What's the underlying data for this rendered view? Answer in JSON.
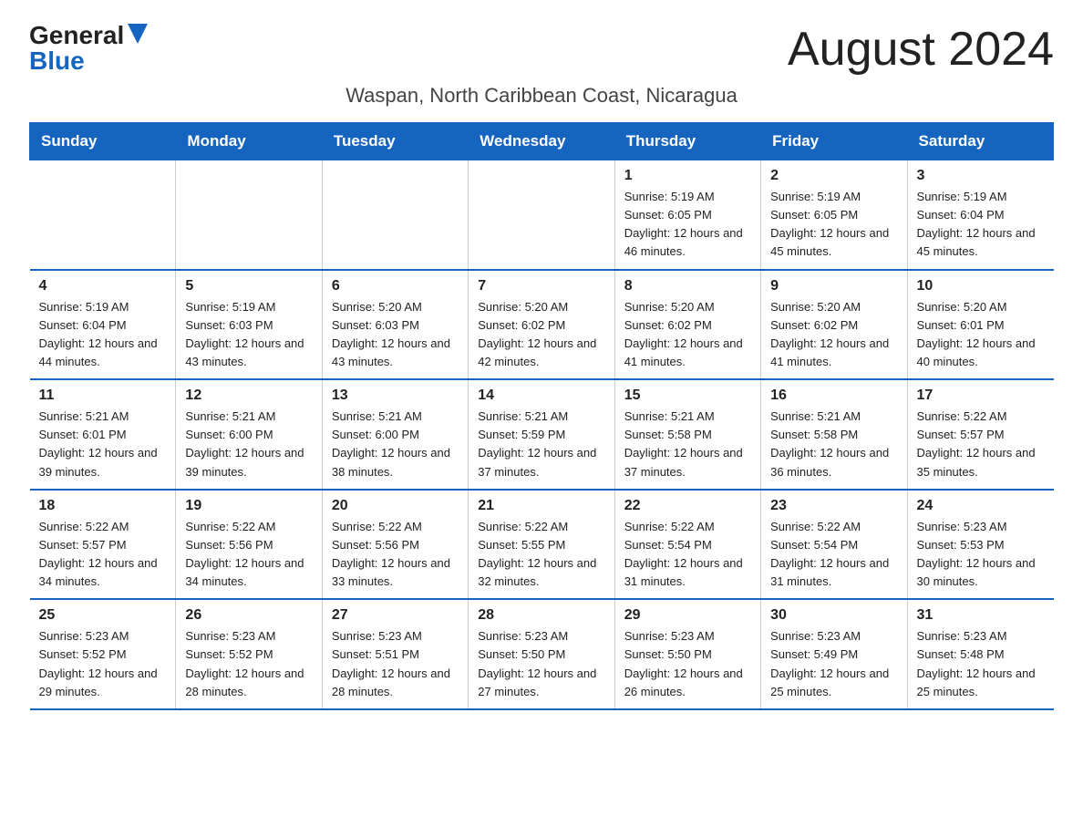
{
  "logo": {
    "general": "General",
    "blue": "Blue"
  },
  "page_title": "August 2024",
  "subtitle": "Waspan, North Caribbean Coast, Nicaragua",
  "header_days": [
    "Sunday",
    "Monday",
    "Tuesday",
    "Wednesday",
    "Thursday",
    "Friday",
    "Saturday"
  ],
  "weeks": [
    [
      {
        "day": "",
        "sunrise": "",
        "sunset": "",
        "daylight": ""
      },
      {
        "day": "",
        "sunrise": "",
        "sunset": "",
        "daylight": ""
      },
      {
        "day": "",
        "sunrise": "",
        "sunset": "",
        "daylight": ""
      },
      {
        "day": "",
        "sunrise": "",
        "sunset": "",
        "daylight": ""
      },
      {
        "day": "1",
        "sunrise": "Sunrise: 5:19 AM",
        "sunset": "Sunset: 6:05 PM",
        "daylight": "Daylight: 12 hours and 46 minutes."
      },
      {
        "day": "2",
        "sunrise": "Sunrise: 5:19 AM",
        "sunset": "Sunset: 6:05 PM",
        "daylight": "Daylight: 12 hours and 45 minutes."
      },
      {
        "day": "3",
        "sunrise": "Sunrise: 5:19 AM",
        "sunset": "Sunset: 6:04 PM",
        "daylight": "Daylight: 12 hours and 45 minutes."
      }
    ],
    [
      {
        "day": "4",
        "sunrise": "Sunrise: 5:19 AM",
        "sunset": "Sunset: 6:04 PM",
        "daylight": "Daylight: 12 hours and 44 minutes."
      },
      {
        "day": "5",
        "sunrise": "Sunrise: 5:19 AM",
        "sunset": "Sunset: 6:03 PM",
        "daylight": "Daylight: 12 hours and 43 minutes."
      },
      {
        "day": "6",
        "sunrise": "Sunrise: 5:20 AM",
        "sunset": "Sunset: 6:03 PM",
        "daylight": "Daylight: 12 hours and 43 minutes."
      },
      {
        "day": "7",
        "sunrise": "Sunrise: 5:20 AM",
        "sunset": "Sunset: 6:02 PM",
        "daylight": "Daylight: 12 hours and 42 minutes."
      },
      {
        "day": "8",
        "sunrise": "Sunrise: 5:20 AM",
        "sunset": "Sunset: 6:02 PM",
        "daylight": "Daylight: 12 hours and 41 minutes."
      },
      {
        "day": "9",
        "sunrise": "Sunrise: 5:20 AM",
        "sunset": "Sunset: 6:02 PM",
        "daylight": "Daylight: 12 hours and 41 minutes."
      },
      {
        "day": "10",
        "sunrise": "Sunrise: 5:20 AM",
        "sunset": "Sunset: 6:01 PM",
        "daylight": "Daylight: 12 hours and 40 minutes."
      }
    ],
    [
      {
        "day": "11",
        "sunrise": "Sunrise: 5:21 AM",
        "sunset": "Sunset: 6:01 PM",
        "daylight": "Daylight: 12 hours and 39 minutes."
      },
      {
        "day": "12",
        "sunrise": "Sunrise: 5:21 AM",
        "sunset": "Sunset: 6:00 PM",
        "daylight": "Daylight: 12 hours and 39 minutes."
      },
      {
        "day": "13",
        "sunrise": "Sunrise: 5:21 AM",
        "sunset": "Sunset: 6:00 PM",
        "daylight": "Daylight: 12 hours and 38 minutes."
      },
      {
        "day": "14",
        "sunrise": "Sunrise: 5:21 AM",
        "sunset": "Sunset: 5:59 PM",
        "daylight": "Daylight: 12 hours and 37 minutes."
      },
      {
        "day": "15",
        "sunrise": "Sunrise: 5:21 AM",
        "sunset": "Sunset: 5:58 PM",
        "daylight": "Daylight: 12 hours and 37 minutes."
      },
      {
        "day": "16",
        "sunrise": "Sunrise: 5:21 AM",
        "sunset": "Sunset: 5:58 PM",
        "daylight": "Daylight: 12 hours and 36 minutes."
      },
      {
        "day": "17",
        "sunrise": "Sunrise: 5:22 AM",
        "sunset": "Sunset: 5:57 PM",
        "daylight": "Daylight: 12 hours and 35 minutes."
      }
    ],
    [
      {
        "day": "18",
        "sunrise": "Sunrise: 5:22 AM",
        "sunset": "Sunset: 5:57 PM",
        "daylight": "Daylight: 12 hours and 34 minutes."
      },
      {
        "day": "19",
        "sunrise": "Sunrise: 5:22 AM",
        "sunset": "Sunset: 5:56 PM",
        "daylight": "Daylight: 12 hours and 34 minutes."
      },
      {
        "day": "20",
        "sunrise": "Sunrise: 5:22 AM",
        "sunset": "Sunset: 5:56 PM",
        "daylight": "Daylight: 12 hours and 33 minutes."
      },
      {
        "day": "21",
        "sunrise": "Sunrise: 5:22 AM",
        "sunset": "Sunset: 5:55 PM",
        "daylight": "Daylight: 12 hours and 32 minutes."
      },
      {
        "day": "22",
        "sunrise": "Sunrise: 5:22 AM",
        "sunset": "Sunset: 5:54 PM",
        "daylight": "Daylight: 12 hours and 31 minutes."
      },
      {
        "day": "23",
        "sunrise": "Sunrise: 5:22 AM",
        "sunset": "Sunset: 5:54 PM",
        "daylight": "Daylight: 12 hours and 31 minutes."
      },
      {
        "day": "24",
        "sunrise": "Sunrise: 5:23 AM",
        "sunset": "Sunset: 5:53 PM",
        "daylight": "Daylight: 12 hours and 30 minutes."
      }
    ],
    [
      {
        "day": "25",
        "sunrise": "Sunrise: 5:23 AM",
        "sunset": "Sunset: 5:52 PM",
        "daylight": "Daylight: 12 hours and 29 minutes."
      },
      {
        "day": "26",
        "sunrise": "Sunrise: 5:23 AM",
        "sunset": "Sunset: 5:52 PM",
        "daylight": "Daylight: 12 hours and 28 minutes."
      },
      {
        "day": "27",
        "sunrise": "Sunrise: 5:23 AM",
        "sunset": "Sunset: 5:51 PM",
        "daylight": "Daylight: 12 hours and 28 minutes."
      },
      {
        "day": "28",
        "sunrise": "Sunrise: 5:23 AM",
        "sunset": "Sunset: 5:50 PM",
        "daylight": "Daylight: 12 hours and 27 minutes."
      },
      {
        "day": "29",
        "sunrise": "Sunrise: 5:23 AM",
        "sunset": "Sunset: 5:50 PM",
        "daylight": "Daylight: 12 hours and 26 minutes."
      },
      {
        "day": "30",
        "sunrise": "Sunrise: 5:23 AM",
        "sunset": "Sunset: 5:49 PM",
        "daylight": "Daylight: 12 hours and 25 minutes."
      },
      {
        "day": "31",
        "sunrise": "Sunrise: 5:23 AM",
        "sunset": "Sunset: 5:48 PM",
        "daylight": "Daylight: 12 hours and 25 minutes."
      }
    ]
  ]
}
